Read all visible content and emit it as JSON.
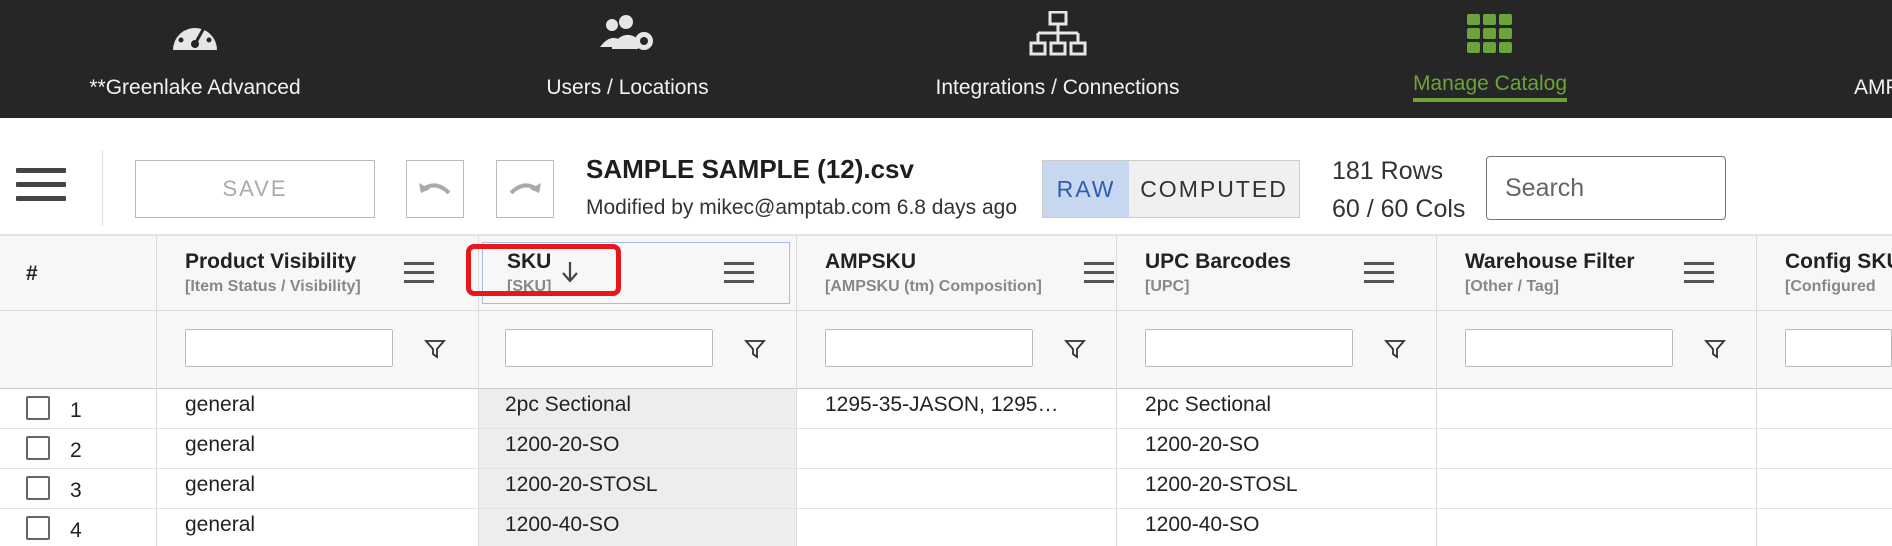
{
  "nav": {
    "items": [
      {
        "label": "**Greenlake Advanced",
        "icon": "dashboard-gauge-icon"
      },
      {
        "label": "Users / Locations",
        "icon": "users-gear-icon"
      },
      {
        "label": "Integrations / Connections",
        "icon": "network-icon"
      },
      {
        "label": "Manage Catalog",
        "icon": "grid-apps-icon",
        "active": true
      },
      {
        "label": "AMP",
        "icon": ""
      }
    ],
    "active_color": "#6aa43a"
  },
  "toolbar": {
    "save_label": "SAVE",
    "file_title": "SAMPLE SAMPLE (12).csv",
    "modified": "Modified by mikec@amptab.com 6.8 days ago",
    "toggle_raw": "RAW",
    "toggle_computed": "COMPUTED",
    "rows": "181 Rows",
    "cols": "60 / 60 Cols",
    "search_placeholder": "Search"
  },
  "grid": {
    "hash": "#",
    "columns": [
      {
        "name": "Product Visibility",
        "sub": "[Item Status / Visibility]"
      },
      {
        "name": "SKU",
        "sub": "[SKU]",
        "sorted": "desc"
      },
      {
        "name": "AMPSKU",
        "sub": "[AMPSKU (tm) Composition]"
      },
      {
        "name": "UPC Barcodes",
        "sub": "[UPC]"
      },
      {
        "name": "Warehouse Filter",
        "sub": "[Other / Tag]"
      },
      {
        "name": "Config SKU",
        "sub": "[Configured"
      }
    ],
    "rows": [
      {
        "num": "1",
        "cells": [
          "general",
          "2pc Sectional",
          "1295-35-JASON, 1295…",
          "2pc Sectional",
          "",
          ""
        ]
      },
      {
        "num": "2",
        "cells": [
          "general",
          "1200-20-SO",
          "",
          "1200-20-SO",
          "",
          ""
        ]
      },
      {
        "num": "3",
        "cells": [
          "general",
          "1200-20-STOSL",
          "",
          "1200-20-STOSL",
          "",
          ""
        ]
      },
      {
        "num": "4",
        "cells": [
          "general",
          "1200-40-SO",
          "",
          "1200-40-SO",
          "",
          ""
        ]
      }
    ]
  }
}
